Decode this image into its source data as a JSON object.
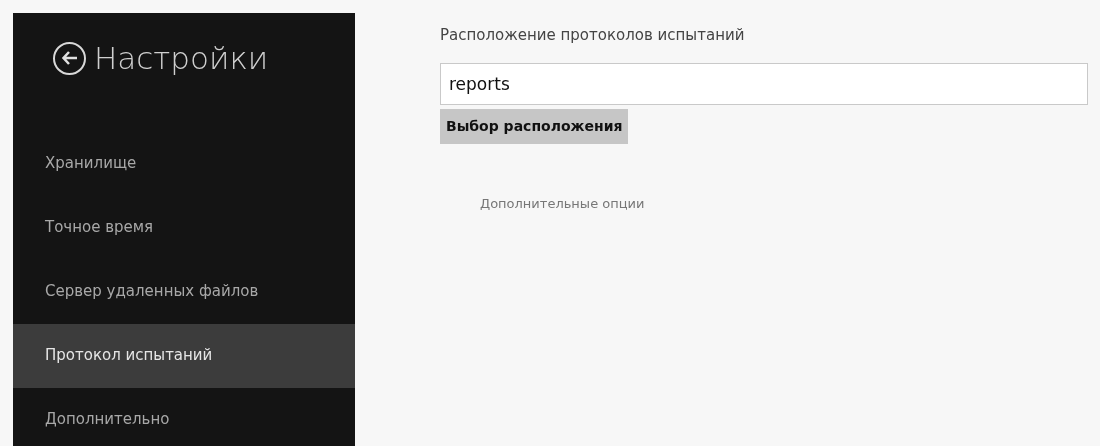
{
  "sidebar": {
    "title": "Настройки",
    "items": [
      {
        "label": "Хранилище",
        "selected": false
      },
      {
        "label": "Точное время",
        "selected": false
      },
      {
        "label": "Сервер удаленных файлов",
        "selected": false
      },
      {
        "label": "Протокол испытаний",
        "selected": true
      },
      {
        "label": "Дополнительно",
        "selected": false
      }
    ]
  },
  "content": {
    "heading": "Расположение протоколов испытаний",
    "path_field": {
      "value": "reports"
    },
    "choose_button": "Выбор расположения",
    "more_link": "Дополнительные опции"
  }
}
